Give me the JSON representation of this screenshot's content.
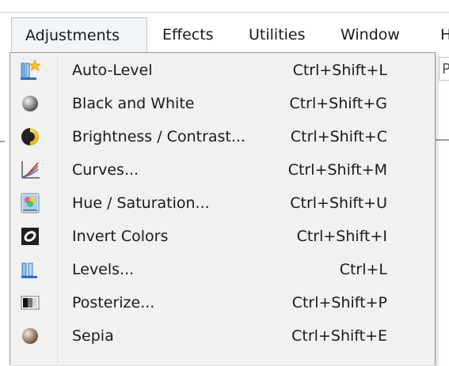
{
  "menubar": {
    "items": [
      "Adjustments",
      "Effects",
      "Utilities",
      "Window",
      "H"
    ],
    "active": "Adjustments"
  },
  "background": {
    "field_text": "P"
  },
  "dropdown": {
    "items": [
      {
        "label": "Auto-Level",
        "shortcut": "Ctrl+Shift+L",
        "icon": "auto-level-icon"
      },
      {
        "label": "Black and White",
        "shortcut": "Ctrl+Shift+G",
        "icon": "black-and-white-icon"
      },
      {
        "label": "Brightness / Contrast...",
        "shortcut": "Ctrl+Shift+C",
        "icon": "brightness-contrast-icon"
      },
      {
        "label": "Curves...",
        "shortcut": "Ctrl+Shift+M",
        "icon": "curves-icon"
      },
      {
        "label": "Hue / Saturation...",
        "shortcut": "Ctrl+Shift+U",
        "icon": "hue-saturation-icon"
      },
      {
        "label": "Invert Colors",
        "shortcut": "Ctrl+Shift+I",
        "icon": "invert-colors-icon"
      },
      {
        "label": "Levels...",
        "shortcut": "Ctrl+L",
        "icon": "levels-icon"
      },
      {
        "label": "Posterize...",
        "shortcut": "Ctrl+Shift+P",
        "icon": "posterize-icon"
      },
      {
        "label": "Sepia",
        "shortcut": "Ctrl+Shift+E",
        "icon": "sepia-icon"
      }
    ]
  },
  "colors": {
    "menu_background": "#f1f1f1",
    "active_tab_background": "#f2f5f8",
    "active_tab_border": "#b9c5d2",
    "menu_border": "#979797"
  }
}
